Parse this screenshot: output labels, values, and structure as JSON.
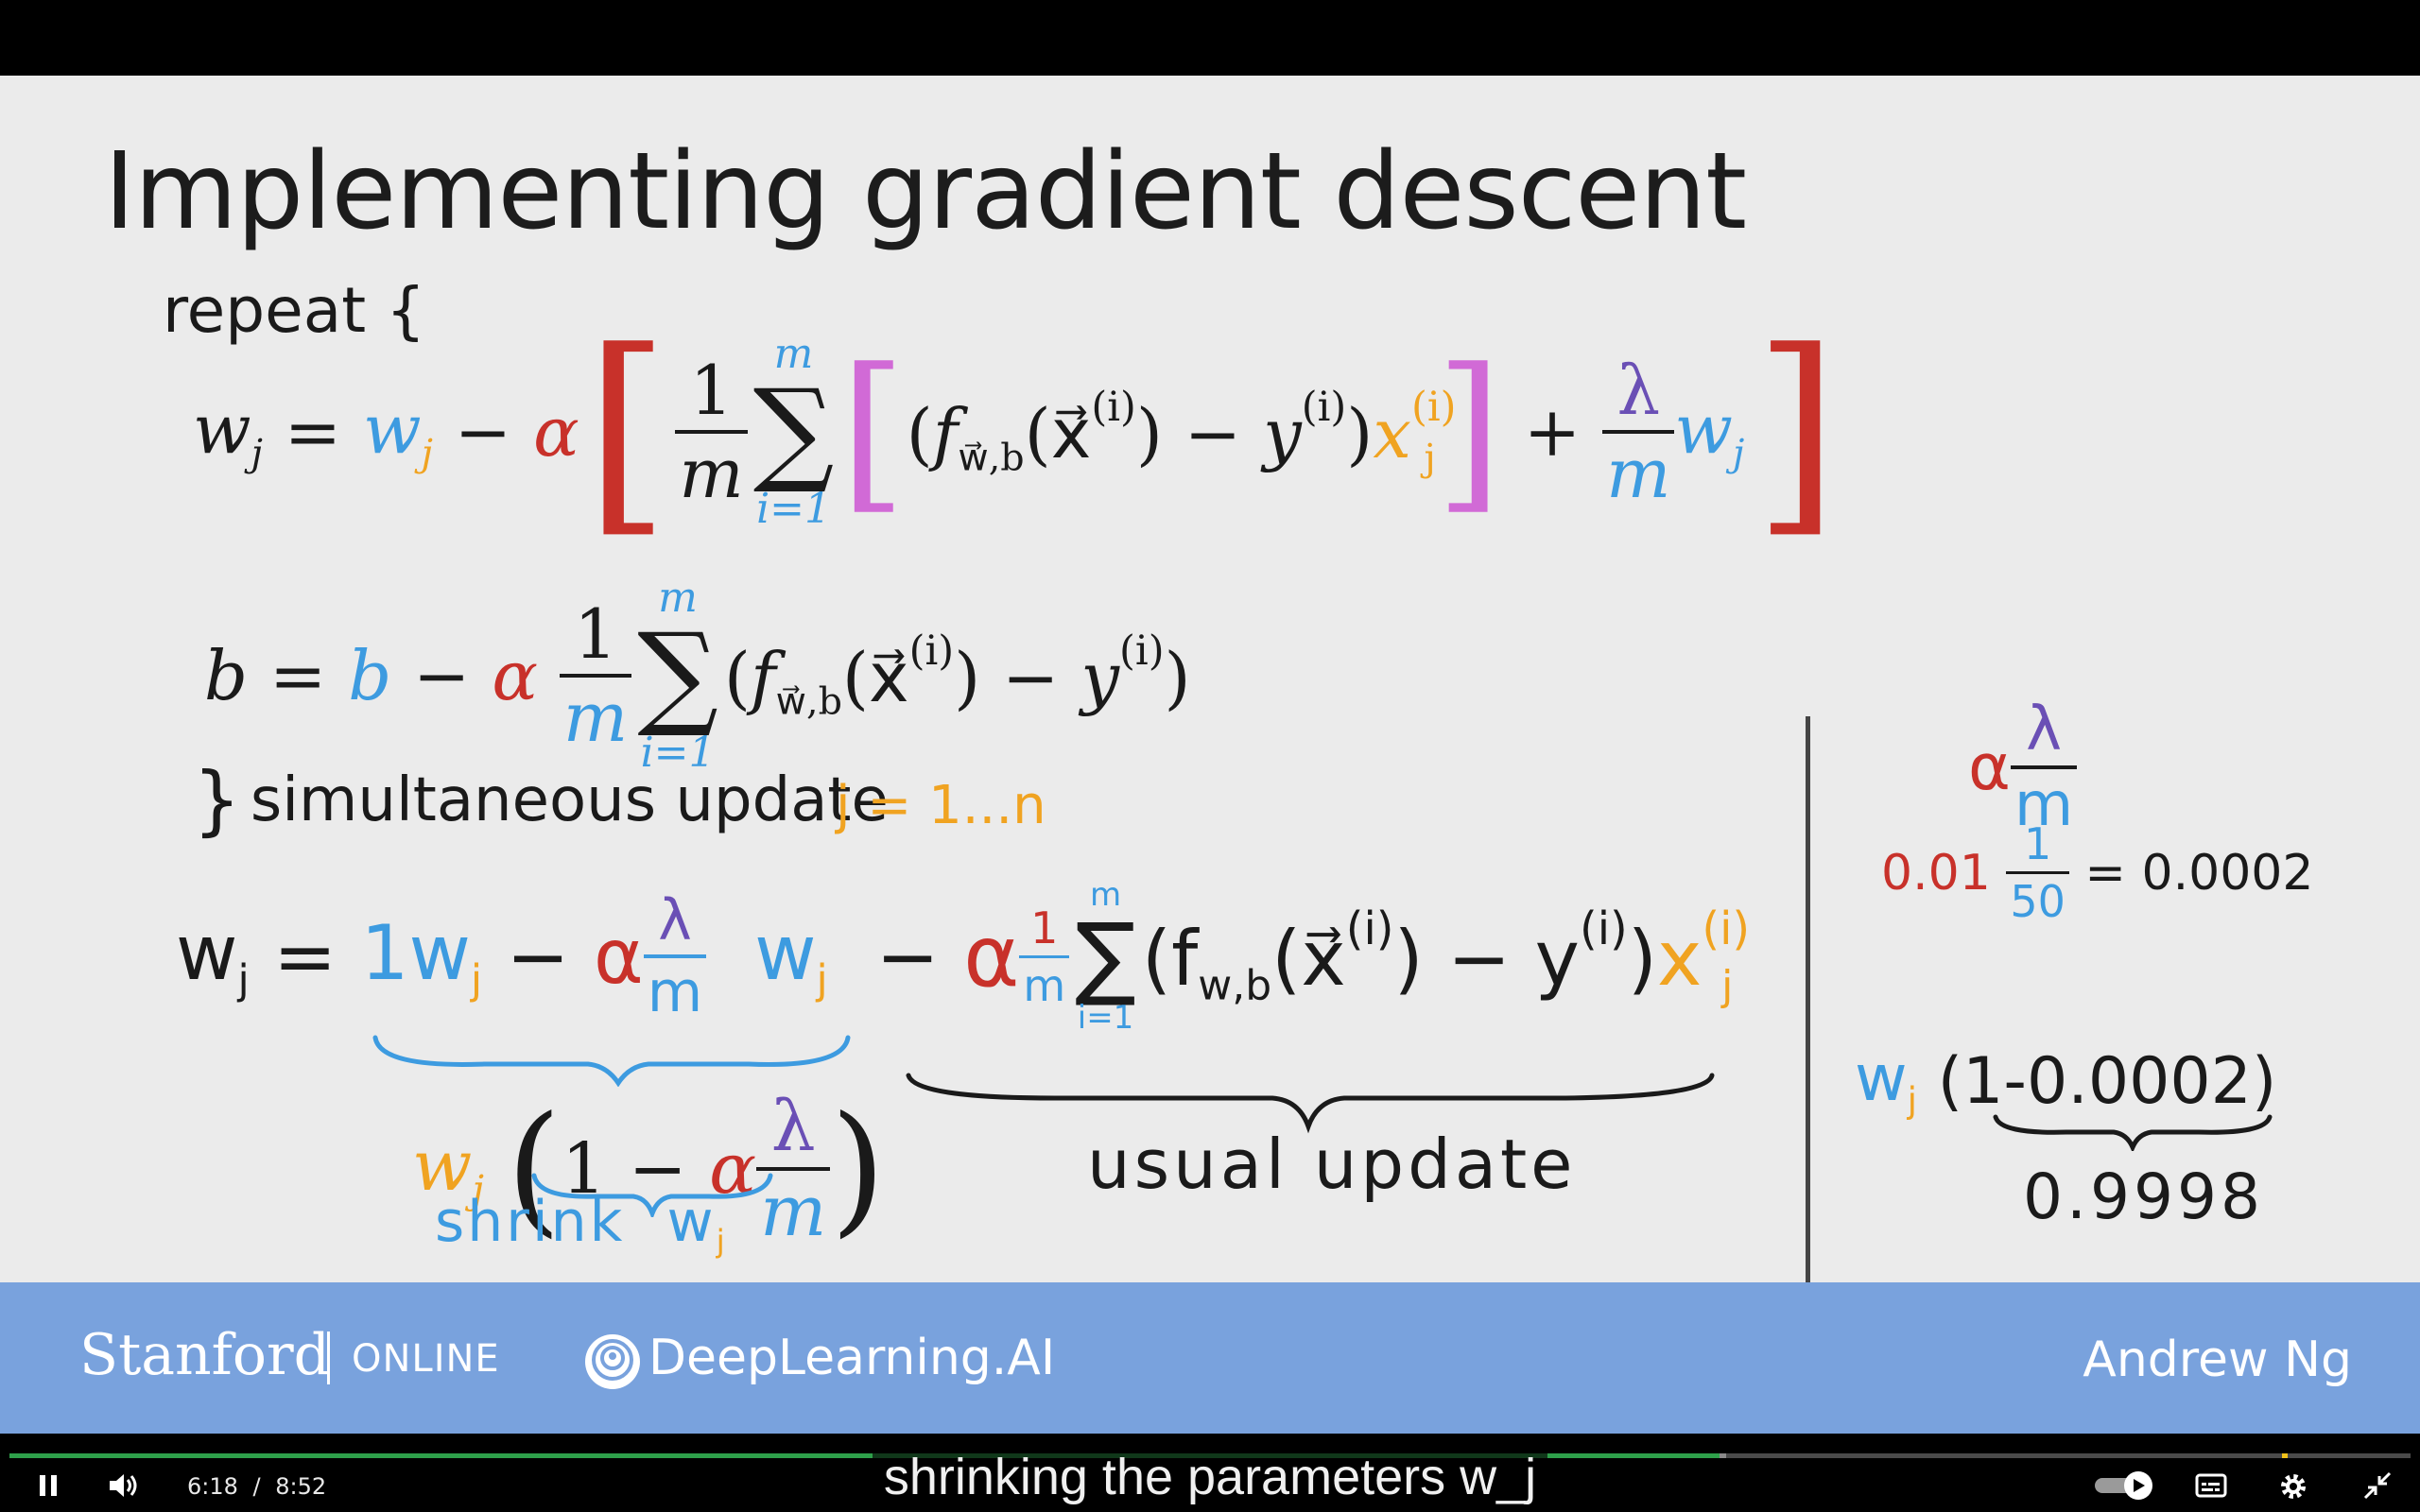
{
  "slide": {
    "title": "Implementing gradient descent",
    "repeat_label": "repeat {",
    "simultaneous_label": "simultaneous update",
    "j_range": "j = 1...n",
    "usual_update": "usual update",
    "shrink_label": "shrink",
    "side_alpha_value": "0.01",
    "side_lambda_value": "1",
    "side_m_value": "50",
    "side_result": "= 0.0002",
    "side_factor": "(1-0.0002)",
    "side_factor_result": "0.9998"
  },
  "banner": {
    "stanford": "Stanford",
    "online": "ONLINE",
    "deeplearning": "DeepLearning.AI",
    "presenter": "Andrew Ng"
  },
  "player": {
    "time_current": "6:18",
    "time_separator": "/",
    "time_total": "8:52",
    "progress_fraction": 0.7124,
    "caption": "shrinking the parameters w_j",
    "played_color": "#2ea04a"
  }
}
